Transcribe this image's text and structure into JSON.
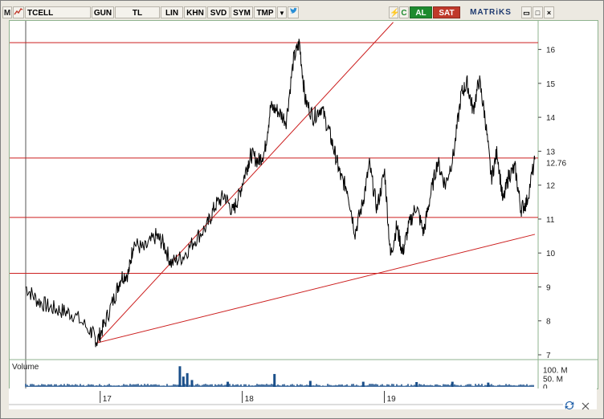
{
  "toolbar": {
    "logo": "M",
    "symbol": "TCELL",
    "buttons": [
      "GUN",
      "TL",
      "LIN",
      "KHN",
      "SVD",
      "SYM",
      "TMP"
    ],
    "dropdown_glyph": "▼",
    "bird_glyph": "🐦",
    "lightning_glyph": "⚡",
    "refresh_glyph": "C",
    "al_label": "AL",
    "sat_label": "SAT",
    "brand": "MATRiKS",
    "win_min": "▭",
    "win_max": "□",
    "win_close": "×"
  },
  "chart_data": {
    "type": "line",
    "title": "",
    "x_ticks": [
      "17",
      "18",
      "19"
    ],
    "y_ticks": [
      16,
      15,
      14,
      13,
      12,
      11,
      10,
      9,
      8,
      7
    ],
    "ylim": [
      7,
      16.7
    ],
    "last_price_label": "12.76",
    "last_price": 12.76,
    "horizontal_levels": [
      16.2,
      12.8,
      11.05,
      9.4
    ],
    "trendlines": [
      {
        "from": [
          "2016-12-01",
          7.35
        ],
        "to": [
          "2019-01-01",
          16.8
        ]
      },
      {
        "from": [
          "2016-12-01",
          7.35
        ],
        "to": [
          "2019-12-31",
          10.55
        ]
      }
    ],
    "price_series": {
      "name": "TCELL",
      "points": [
        [
          "2016-06-01",
          9.0
        ],
        [
          "2016-07-01",
          8.6
        ],
        [
          "2016-08-01",
          8.4
        ],
        [
          "2016-09-01",
          8.3
        ],
        [
          "2016-10-01",
          8.2
        ],
        [
          "2016-11-15",
          7.7
        ],
        [
          "2016-12-01",
          7.4
        ],
        [
          "2016-12-20",
          7.9
        ],
        [
          "2017-01-15",
          8.7
        ],
        [
          "2017-02-01",
          9.3
        ],
        [
          "2017-02-20",
          9.4
        ],
        [
          "2017-03-05",
          10.3
        ],
        [
          "2017-04-01",
          10.1
        ],
        [
          "2017-05-01",
          10.5
        ],
        [
          "2017-05-20",
          10.3
        ],
        [
          "2017-06-10",
          9.7
        ],
        [
          "2017-07-10",
          9.9
        ],
        [
          "2017-08-10",
          10.4
        ],
        [
          "2017-09-10",
          10.8
        ],
        [
          "2017-10-01",
          11.4
        ],
        [
          "2017-10-25",
          11.7
        ],
        [
          "2017-11-15",
          11.2
        ],
        [
          "2017-12-01",
          11.7
        ],
        [
          "2017-12-20",
          12.5
        ],
        [
          "2018-01-01",
          12.9
        ],
        [
          "2018-01-20",
          12.7
        ],
        [
          "2018-02-05",
          13.0
        ],
        [
          "2018-02-20",
          14.3
        ],
        [
          "2018-03-10",
          14.2
        ],
        [
          "2018-04-01",
          13.9
        ],
        [
          "2018-04-20",
          15.7
        ],
        [
          "2018-05-05",
          16.2
        ],
        [
          "2018-05-20",
          14.5
        ],
        [
          "2018-06-10",
          14.0
        ],
        [
          "2018-06-30",
          14.3
        ],
        [
          "2018-07-20",
          13.6
        ],
        [
          "2018-08-05",
          12.9
        ],
        [
          "2018-08-20",
          12.2
        ],
        [
          "2018-09-05",
          11.9
        ],
        [
          "2018-09-25",
          10.6
        ],
        [
          "2018-10-15",
          11.5
        ],
        [
          "2018-11-01",
          12.6
        ],
        [
          "2018-11-20",
          11.3
        ],
        [
          "2018-12-10",
          12.4
        ],
        [
          "2018-12-25",
          9.9
        ],
        [
          "2019-01-10",
          10.8
        ],
        [
          "2019-01-25",
          10.0
        ],
        [
          "2019-02-10",
          10.8
        ],
        [
          "2019-03-01",
          11.4
        ],
        [
          "2019-03-20",
          10.6
        ],
        [
          "2019-04-05",
          11.6
        ],
        [
          "2019-04-25",
          12.7
        ],
        [
          "2019-05-15",
          12.0
        ],
        [
          "2019-06-05",
          12.9
        ],
        [
          "2019-06-25",
          14.7
        ],
        [
          "2019-07-10",
          15.0
        ],
        [
          "2019-07-25",
          14.2
        ],
        [
          "2019-08-10",
          15.1
        ],
        [
          "2019-08-25",
          14.0
        ],
        [
          "2019-09-10",
          12.2
        ],
        [
          "2019-09-25",
          13.0
        ],
        [
          "2019-10-10",
          11.5
        ],
        [
          "2019-10-25",
          12.3
        ],
        [
          "2019-11-10",
          12.5
        ],
        [
          "2019-11-25",
          11.3
        ],
        [
          "2019-12-10",
          11.5
        ],
        [
          "2019-12-31",
          12.76
        ]
      ]
    },
    "volume_panel": {
      "label": "Volume",
      "y_ticks": [
        "100. M",
        "50. M",
        "0"
      ],
      "ylim": [
        0,
        140
      ],
      "baseline": 15,
      "spikes": [
        [
          "2017-07-01",
          120
        ],
        [
          "2017-07-10",
          60
        ],
        [
          "2017-07-20",
          80
        ],
        [
          "2017-08-01",
          40
        ],
        [
          "2017-11-01",
          30
        ],
        [
          "2018-03-01",
          75
        ],
        [
          "2018-06-01",
          35
        ],
        [
          "2018-10-15",
          30
        ],
        [
          "2019-03-01",
          28
        ],
        [
          "2019-06-01",
          30
        ],
        [
          "2019-09-01",
          25
        ]
      ]
    },
    "colors": {
      "price_line": "#000000",
      "level_lines": "#cc1f1f",
      "volume_bars": "#1a4f8a",
      "panel_border": "#8fb38f"
    }
  }
}
